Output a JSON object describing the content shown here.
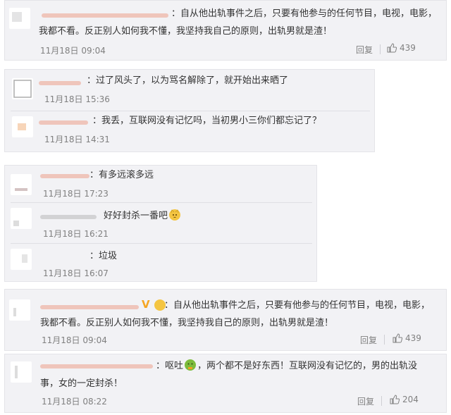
{
  "comments": [
    {
      "text_line1": "：自从他出轨事件之后，只要有他参与的任何节目，电视，电影，",
      "text_line2": "我都不看。反正别人如何我不懂，我坚持我自己的原则，出轨男就是渣！",
      "time": "11月18日 09:04",
      "reply_label": "回复",
      "likes": "439"
    },
    {
      "text": "：过了风头了，以为骂名解除了，就开始出来晒了",
      "time": "11月18日 15:36"
    },
    {
      "text": "：我丢，互联网没有记忆吗，当初男小三你们都忘记了？",
      "time": "11月18日 14:31"
    },
    {
      "text": "：有多远滚多远",
      "time": "11月18日 17:23"
    },
    {
      "text": "好好封杀一番吧",
      "emoji": "cat-face-icon",
      "time": "11月18日 16:21"
    },
    {
      "text": "：垃圾",
      "time": "11月18日 16:07"
    },
    {
      "badge": "V",
      "text_line1": "：自从他出轨事件之后，只要有他参与的任何节目，电视，电影，",
      "text_line2": "我都不看。反正别人如何我不懂，我坚持我自己的原则，出轨男就是渣！",
      "time": "11月18日 09:04",
      "reply_label": "回复",
      "likes": "439"
    },
    {
      "text_pre": "：呕吐",
      "emoji": "vomit-face-icon",
      "text_post": "，两个都不是好东西！互联网没有记忆的，男的出轨没",
      "text_line2": "事，女的一定封杀！",
      "time": "11月18日 08:22",
      "reply_label": "回复",
      "likes": "204"
    }
  ],
  "colors": {
    "background": "#f2f2f5",
    "username": "#eb7350",
    "meta": "#808080",
    "text": "#333333"
  }
}
